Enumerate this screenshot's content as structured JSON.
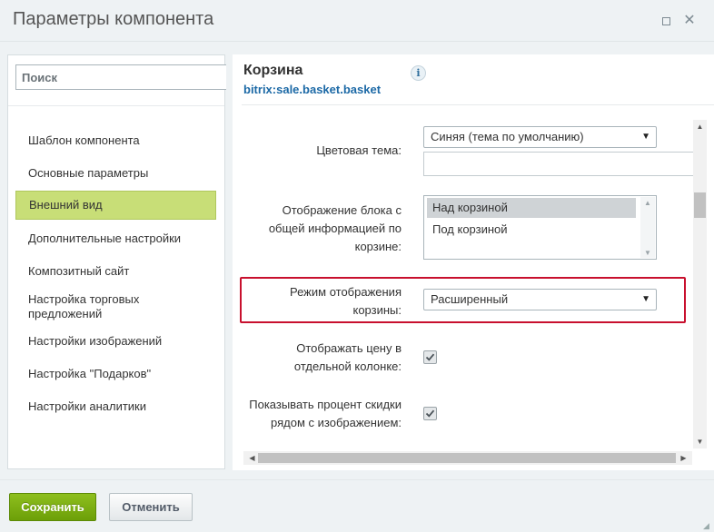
{
  "window": {
    "title": "Параметры компонента",
    "maximize_icon": "maximize-icon",
    "close_icon": "close-icon",
    "close_glyph": "✕"
  },
  "sidebar": {
    "search_placeholder": "Поиск",
    "items": [
      {
        "label": "Шаблон компонента",
        "active": false
      },
      {
        "label": "Основные параметры",
        "active": false
      },
      {
        "label": "Внешний вид",
        "active": true
      },
      {
        "label": "Дополнительные настройки",
        "active": false
      },
      {
        "label": "Композитный сайт",
        "active": false
      },
      {
        "label": "Настройка торговых предложений",
        "active": false
      },
      {
        "label": "Настройки изображений",
        "active": false
      },
      {
        "label": "Настройка \"Подарков\"",
        "active": false
      },
      {
        "label": "Настройки аналитики",
        "active": false
      }
    ],
    "active_color": "#c8de77"
  },
  "component": {
    "title": "Корзина",
    "code": "bitrix:sale.basket.basket",
    "info_glyph": "i"
  },
  "params": {
    "color_theme": {
      "label": "Цветовая тема:",
      "value": "Синяя (тема по умолчанию)",
      "extra_value": ""
    },
    "total_block": {
      "label": "Отображение блока с общей информацией по корзине:",
      "options": [
        "Над корзиной",
        "Под корзиной"
      ],
      "selected": "Над корзиной"
    },
    "display_mode": {
      "label": "Режим отображения корзины:",
      "value": "Расширенный",
      "highlighted": true
    },
    "price_column": {
      "label": "Отображать цену в отдельной колонке:",
      "checked": true
    },
    "discount_percent": {
      "label": "Показывать процент скидки рядом с изображением:",
      "checked": true
    }
  },
  "footer": {
    "save_label": "Сохранить",
    "cancel_label": "Отменить"
  },
  "colors": {
    "highlight": "#c8102e",
    "save_button": "#7aad10",
    "link": "#1c69a6"
  }
}
